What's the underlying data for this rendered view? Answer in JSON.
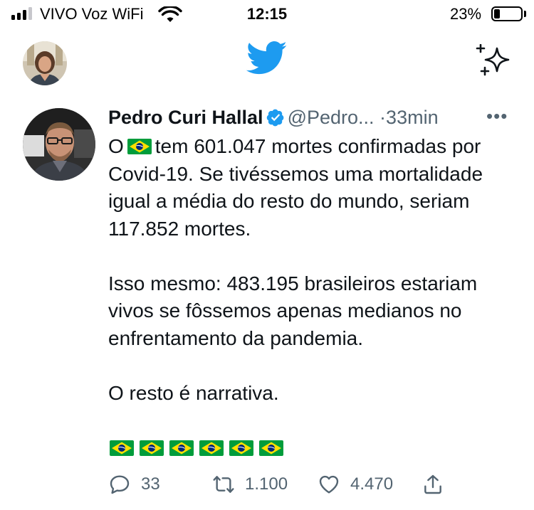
{
  "status_bar": {
    "carrier": "VIVO Voz WiFi",
    "time": "12:15",
    "battery_percent": "23%",
    "battery_level": 0.23,
    "signal_bars": 3,
    "signal_bars_total": 4
  },
  "header": {
    "avatar_icon": "user-avatar",
    "logo_icon": "twitter-bird-icon",
    "sparkle_icon": "sparkle-icon"
  },
  "tweet": {
    "author_name": "Pedro Curi Hallal",
    "handle": "@Pedro...",
    "separator": "·",
    "time": "33min",
    "more_label": "•••",
    "body": {
      "p1_prefix": "O",
      "p1_rest": "tem 601.047 mortes confirmadas por Covid-19. Se tivéssemos uma mortalidade igual a média do resto do mundo, seriam 117.852 mortes.",
      "p2": "Isso mesmo: 483.195 brasileiros estariam vivos se fôssemos apenas medianos no enfrentamento da pandemia.",
      "p3": "O resto é narrativa.",
      "flag_emoji": "brazil-flag",
      "flag_count": 6
    },
    "actions": {
      "replies": "33",
      "retweets": "1.100",
      "likes": "4.470"
    },
    "colors": {
      "twitter_blue": "#1d9bf0",
      "secondary_text": "#536471",
      "flag_green": "#009c3b",
      "flag_yellow": "#ffdf00",
      "flag_blue": "#002776"
    }
  }
}
